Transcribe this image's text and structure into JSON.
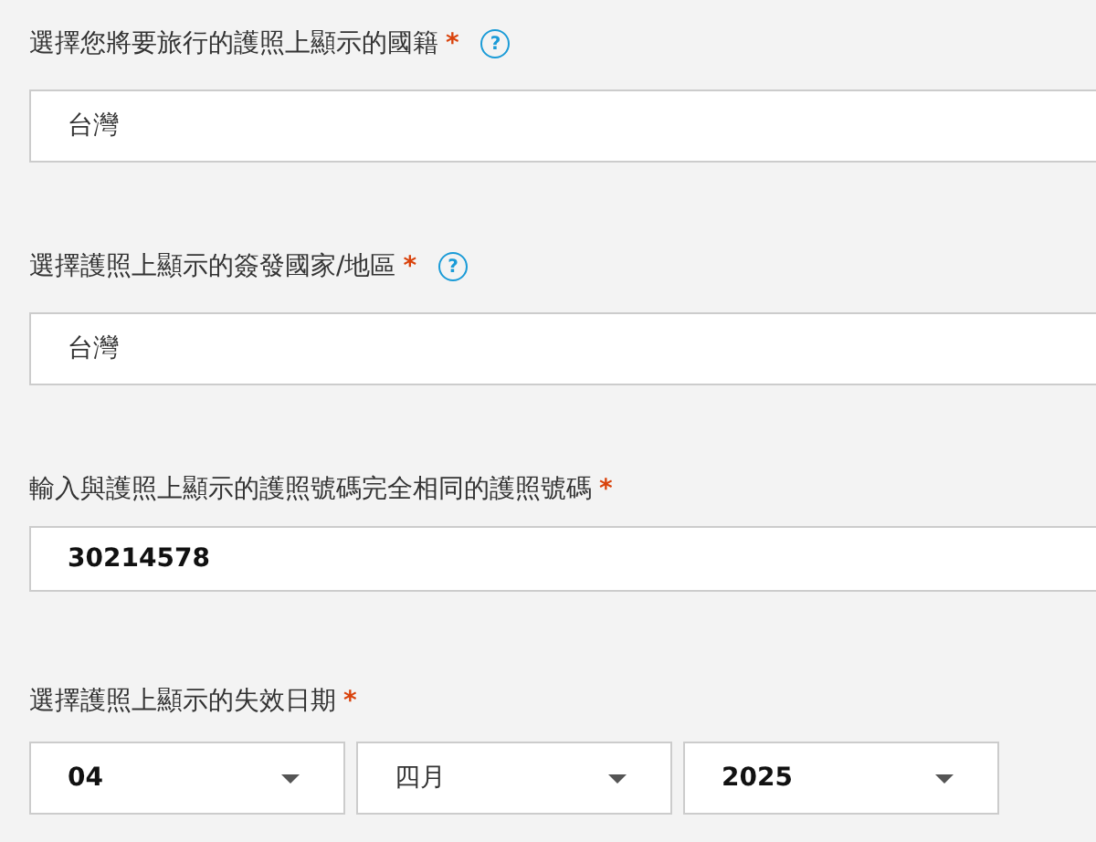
{
  "fields": [
    {
      "kind": "select",
      "label": "選擇您將要旅行的護照上顯示的國籍",
      "required": "*",
      "help": "?",
      "value": "台灣"
    },
    {
      "kind": "select",
      "label": "選擇護照上顯示的簽發國家/地區",
      "required": "*",
      "help": "?",
      "value": "台灣"
    },
    {
      "kind": "text",
      "label": "輸入與護照上顯示的護照號碼完全相同的護照號碼",
      "required": "*",
      "value": "30214578"
    },
    {
      "kind": "date",
      "label": "選擇護照上顯示的失效日期",
      "required": "*",
      "parts": [
        {
          "kind": "number",
          "value": "04"
        },
        {
          "kind": "month",
          "value": "四月"
        },
        {
          "kind": "number",
          "value": "2025"
        }
      ]
    }
  ]
}
